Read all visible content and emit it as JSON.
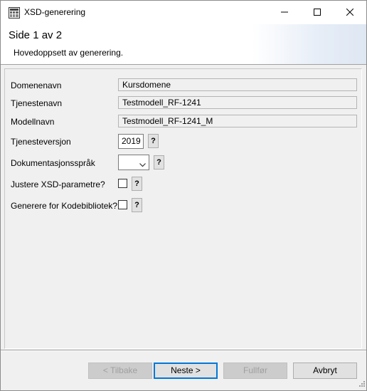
{
  "window": {
    "title": "XSD-generering",
    "app_icon": "xsd-app-icon",
    "controls": {
      "minimize": "minimize-icon",
      "maximize": "maximize-icon",
      "close": "close-icon"
    }
  },
  "header": {
    "title": "Side 1 av 2",
    "description": "Hovedoppsett av generering."
  },
  "form": {
    "domenenavn": {
      "label": "Domenenavn",
      "value": "Kursdomene"
    },
    "tjenestenavn": {
      "label": "Tjenestenavn",
      "value": "Testmodell_RF-1241"
    },
    "modellnavn": {
      "label": "Modellnavn",
      "value": "Testmodell_RF-1241_M"
    },
    "tjenesteversjon": {
      "label": "Tjenesteversjon",
      "value": "2019",
      "help": "?"
    },
    "dokumentasjonssprak": {
      "label": "Dokumentasjonsspråk",
      "value": "",
      "help": "?"
    },
    "justere_xsd": {
      "label": "Justere XSD-parametre?",
      "checked": false,
      "help": "?"
    },
    "kodebibliotek": {
      "label": "Generere for Kodebibliotek?",
      "checked": false,
      "help": "?"
    }
  },
  "buttons": {
    "back": "< Tilbake",
    "next": "Neste >",
    "finish": "Fullfør",
    "cancel": "Avbryt"
  }
}
